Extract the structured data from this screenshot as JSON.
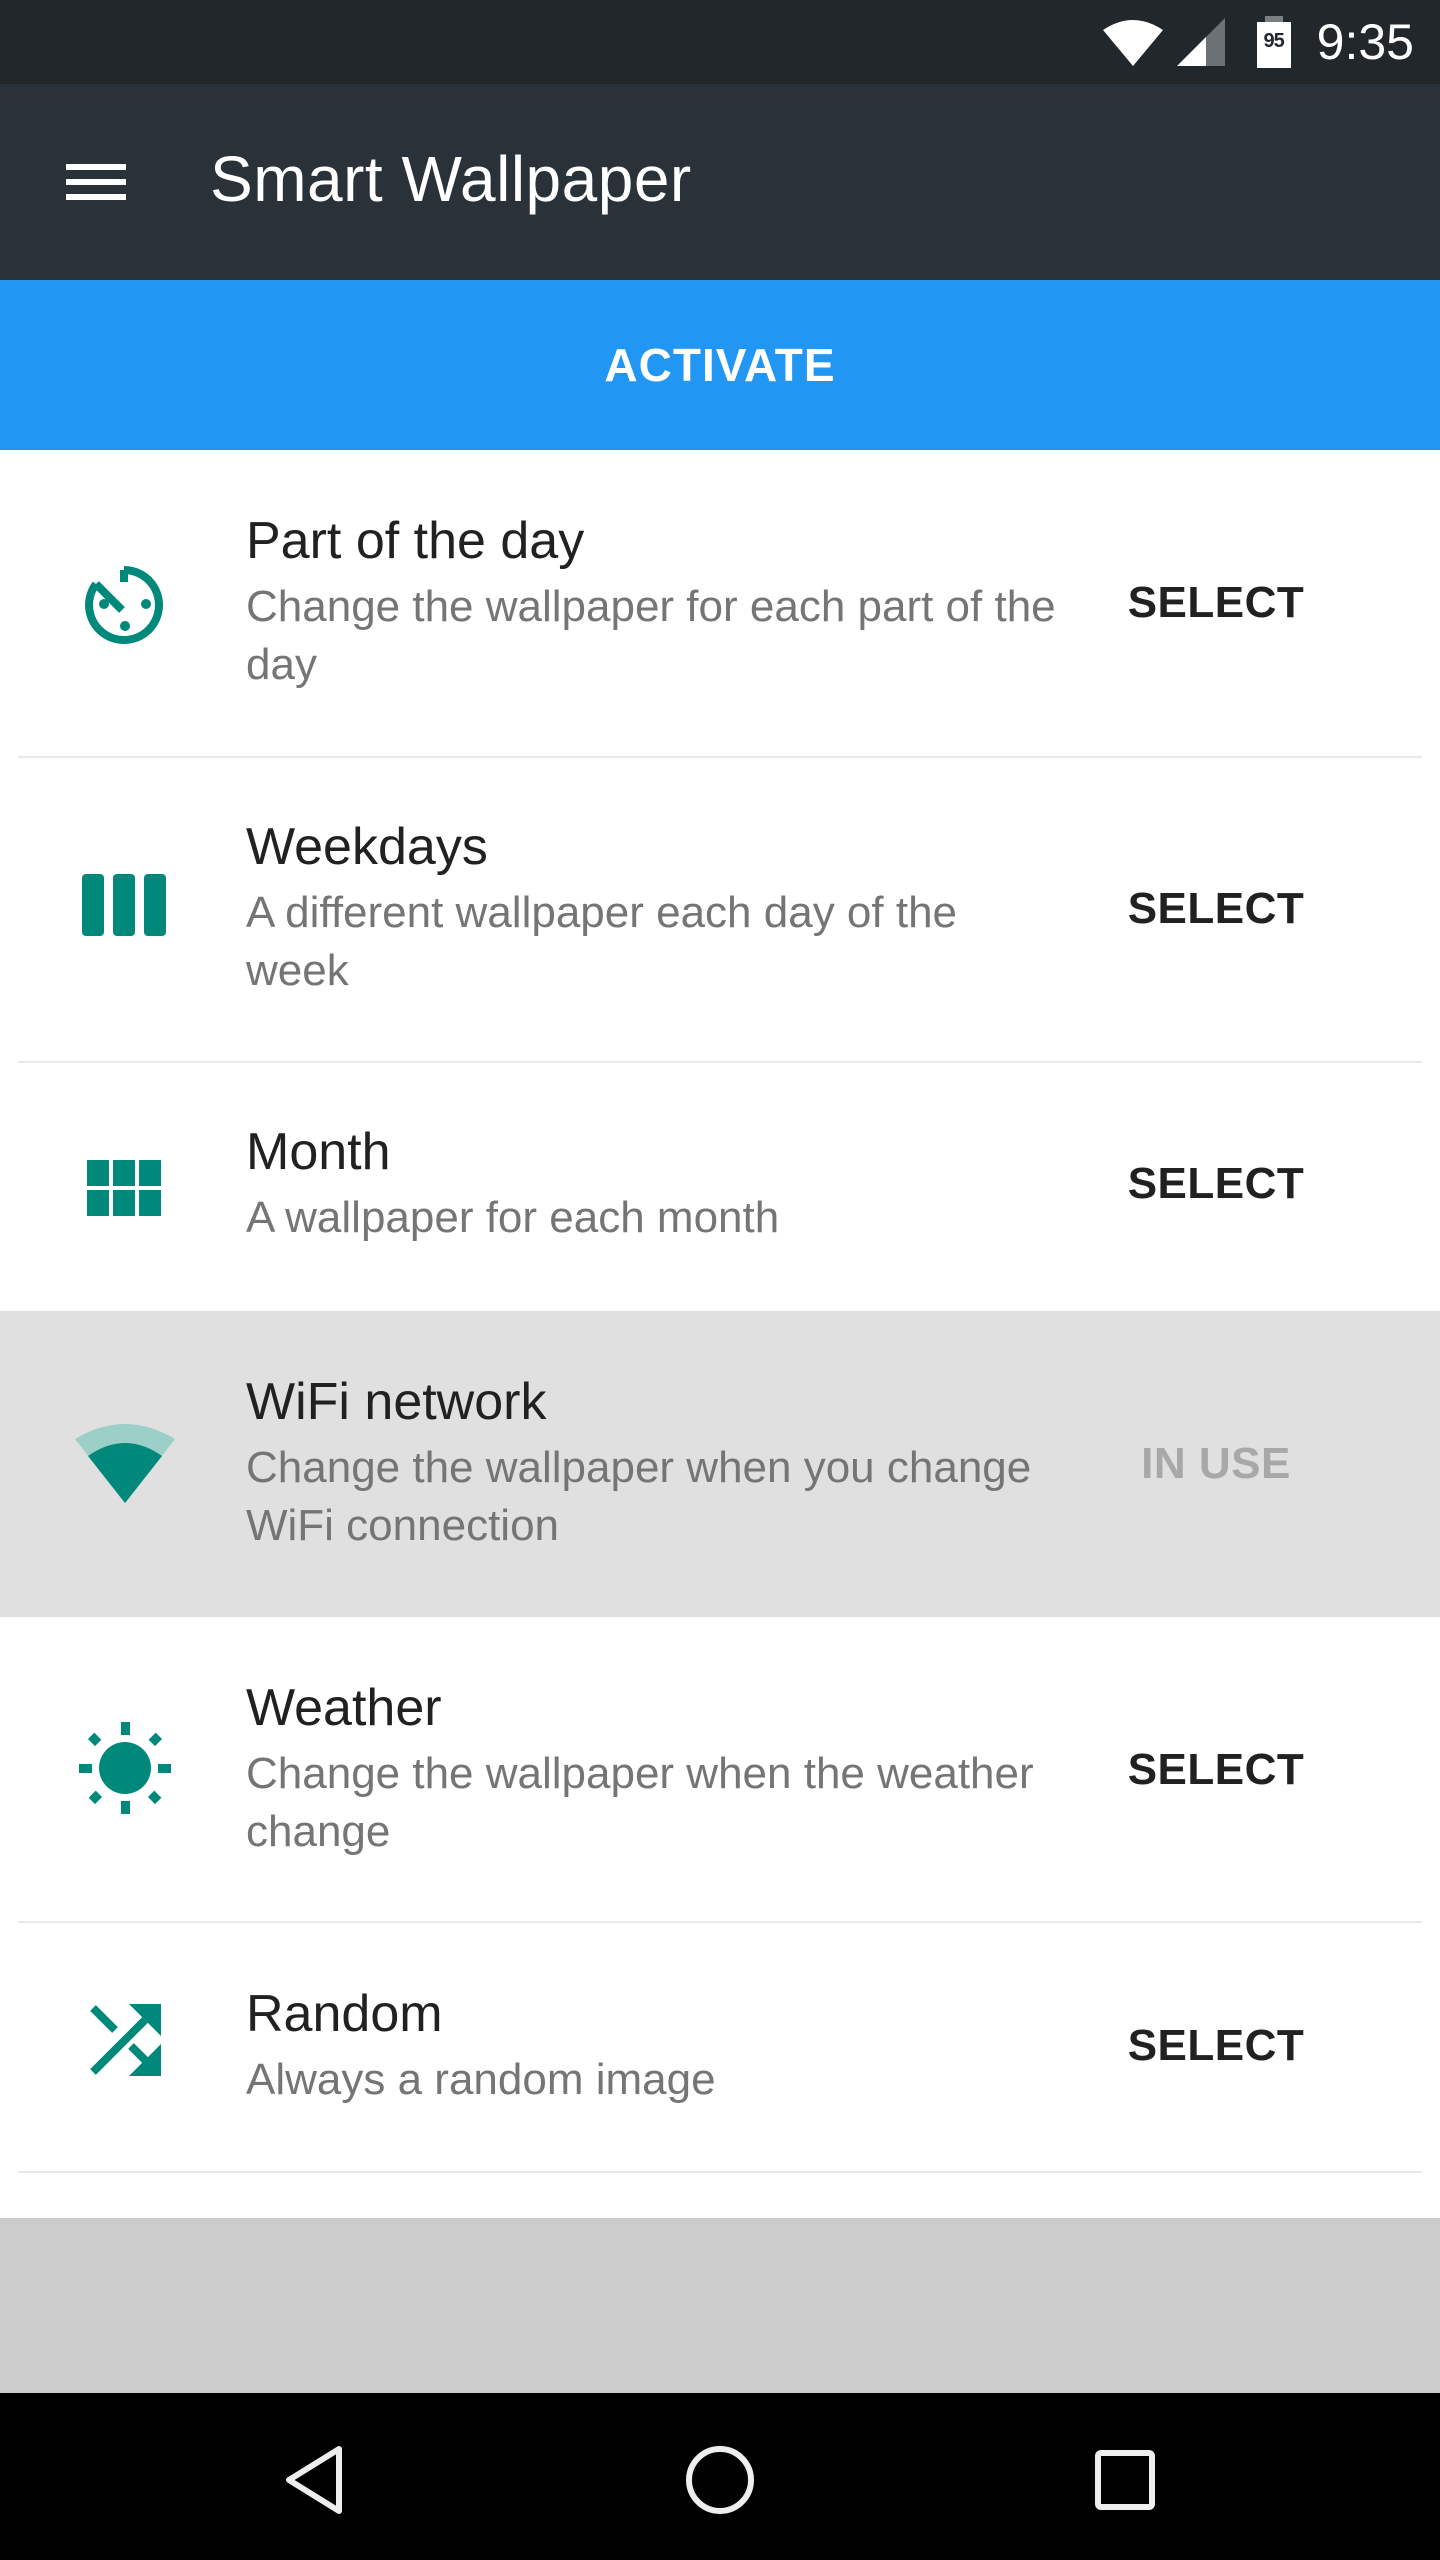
{
  "status_bar": {
    "battery_level": "95",
    "time": "9:35",
    "icons": [
      "wifi-icon",
      "cell-signal-icon",
      "battery-icon"
    ]
  },
  "app_bar": {
    "title": "Smart Wallpaper",
    "menu_icon": "hamburger-menu-icon"
  },
  "activate": {
    "label": "ACTIVATE",
    "color": "#2196f3"
  },
  "theme": {
    "accent": "#00897b",
    "app_bar_bg": "#283238",
    "status_bar_bg": "#21272b",
    "in_use_bg": "#e0e0e0"
  },
  "modes": [
    {
      "icon": "timelapse-clock-icon",
      "title": "Part of the day",
      "subtitle": "Change the wallpaper for each part of the day",
      "action": "SELECT",
      "in_use": false
    },
    {
      "icon": "week-columns-icon",
      "title": "Weekdays",
      "subtitle": "A different wallpaper each day of the week",
      "action": "SELECT",
      "in_use": false
    },
    {
      "icon": "month-grid-icon",
      "title": "Month",
      "subtitle": "A wallpaper for each month",
      "action": "SELECT",
      "in_use": false
    },
    {
      "icon": "wifi-icon",
      "title": "WiFi network",
      "subtitle": "Change the wallpaper when you change WiFi connection",
      "action": "IN USE",
      "in_use": true
    },
    {
      "icon": "sun-icon",
      "title": "Weather",
      "subtitle": "Change the wallpaper when the weather change",
      "action": "SELECT",
      "in_use": false
    },
    {
      "icon": "shuffle-icon",
      "title": "Random",
      "subtitle": "Always a random image",
      "action": "SELECT",
      "in_use": false
    }
  ],
  "nav_bar": {
    "buttons": [
      "back-icon",
      "home-icon",
      "recents-icon"
    ]
  }
}
